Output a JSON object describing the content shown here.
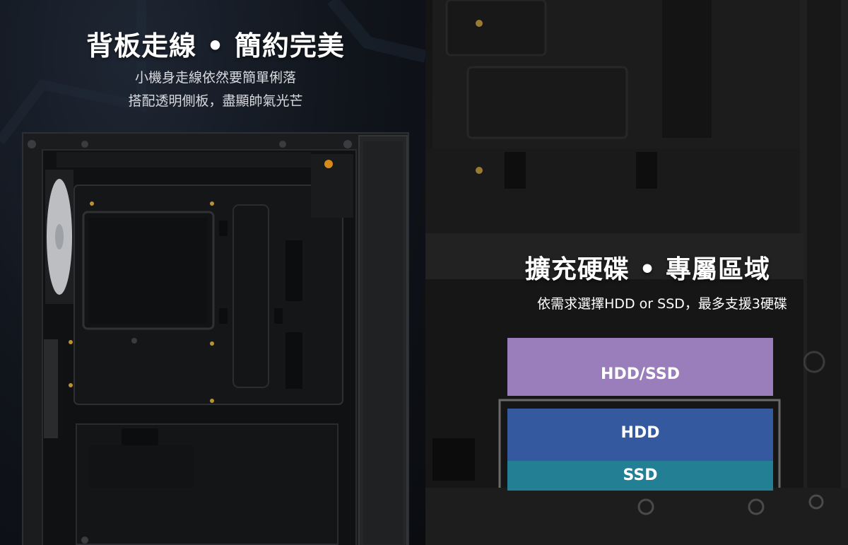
{
  "left_section": {
    "title": "背板走線 • 簡約完美",
    "lines": [
      "小機身走線依然要簡單俐落",
      "搭配透明側板，盡顯帥氣光芒"
    ]
  },
  "right_section": {
    "title": "擴充硬碟 • 專屬區域",
    "subtitle": "依需求選擇HDD or SSD，最多支援3硬碟",
    "drive_labels": {
      "hdd_ssd": "HDD/SSD",
      "hdd": "HDD",
      "ssd": "SSD"
    }
  },
  "colors": {
    "hdd_ssd_highlight": "#a88acd",
    "hdd_highlight": "#3760aa",
    "ssd_highlight": "#2489a0"
  }
}
